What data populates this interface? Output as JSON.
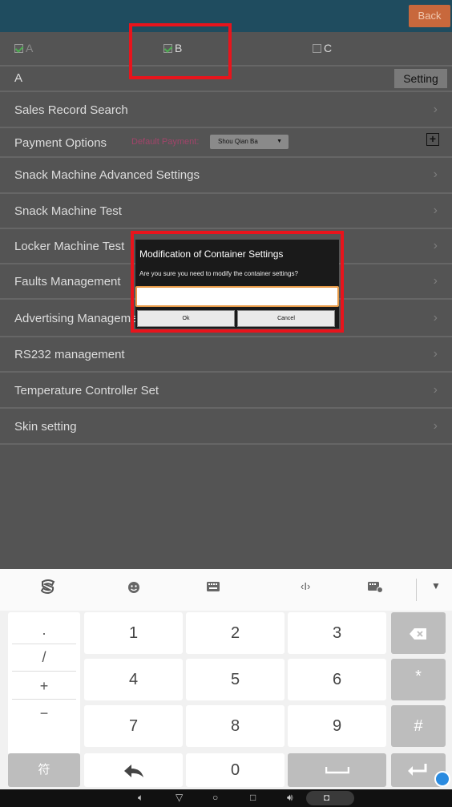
{
  "header": {
    "back_label": "Back"
  },
  "checkboxes": [
    {
      "label": "A",
      "checked": true,
      "disabled": true
    },
    {
      "label": "B",
      "checked": true,
      "disabled": false
    },
    {
      "label": "C",
      "checked": false,
      "disabled": false
    }
  ],
  "setting_row": {
    "label": "A",
    "button": "Setting"
  },
  "rows": {
    "sales": "Sales Record Search",
    "payment": "Payment Options",
    "payment_default_label": "Default Payment:",
    "payment_selected": "Shou Qian Ba",
    "snack_adv": "Snack Machine Advanced Settings",
    "snack_test": "Snack Machine Test",
    "locker_test": "Locker Machine Test",
    "faults": "Faults Management",
    "advertising": "Advertising Management",
    "rs232": "RS232 management",
    "temperature": "Temperature Controller Set",
    "skin": "Skin setting"
  },
  "dialog": {
    "title": "Modification of Container Settings",
    "message": "Are you sure you need to modify the container settings?",
    "input_value": "",
    "ok_label": "Ok",
    "cancel_label": "Cancel"
  },
  "keyboard": {
    "symbols": [
      ".",
      "/",
      "+",
      "−"
    ],
    "digits": [
      "1",
      "2",
      "3",
      "4",
      "5",
      "6",
      "7",
      "8",
      "9",
      "0"
    ],
    "star": "*",
    "hash": "#",
    "switch_label": "符"
  },
  "colors": {
    "header": "#1f4c5f",
    "back_button": "#c8683c",
    "highlight": "#e8141c",
    "payment_label": "#a2446a",
    "input_border": "#e79a47"
  }
}
